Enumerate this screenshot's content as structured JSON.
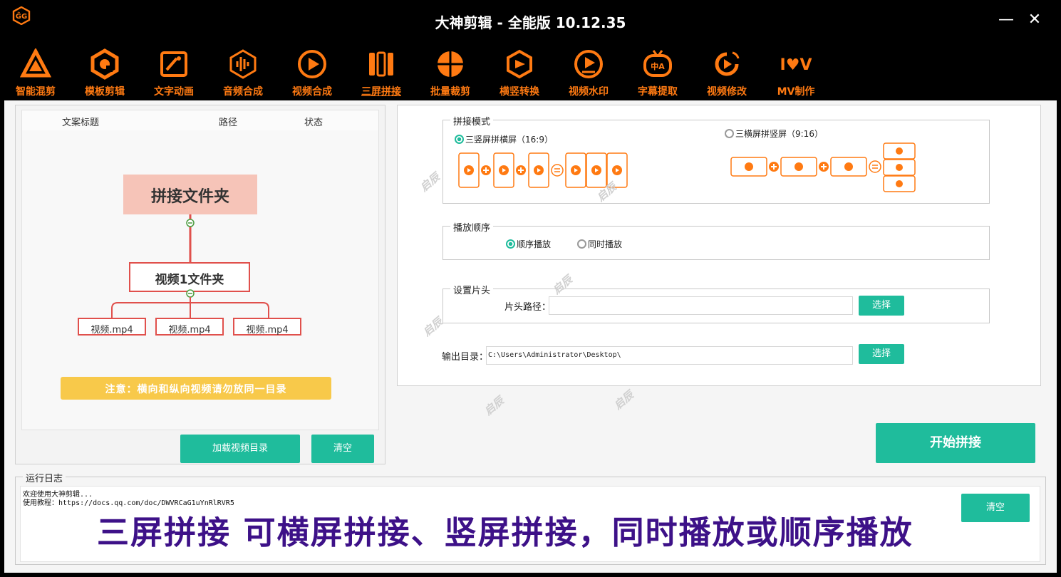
{
  "window": {
    "title": "大神剪辑 - 全能版 10.12.35",
    "minimize": "—",
    "close": "✕"
  },
  "toolbar": [
    {
      "label": "智能混剪",
      "icon": "triangle-logo-icon"
    },
    {
      "label": "模板剪辑",
      "icon": "hexagon-template-icon"
    },
    {
      "label": "文字动画",
      "icon": "text-frame-icon"
    },
    {
      "label": "音频合成",
      "icon": "audio-wave-icon"
    },
    {
      "label": "视频合成",
      "icon": "video-play-icon"
    },
    {
      "label": "三屏拼接",
      "icon": "three-panel-icon"
    },
    {
      "label": "批量裁剪",
      "icon": "crop-ball-icon"
    },
    {
      "label": "横竖转换",
      "icon": "rotate-cube-icon"
    },
    {
      "label": "视频水印",
      "icon": "watermark-icon"
    },
    {
      "label": "字幕提取",
      "icon": "subtitle-tv-icon"
    },
    {
      "label": "视频修改",
      "icon": "edit-play-icon"
    },
    {
      "label": "MV制作",
      "icon": "mv-logo-icon"
    }
  ],
  "active_tool": "三屏拼接",
  "list": {
    "columns": [
      "文案标题",
      "路径",
      "状态"
    ]
  },
  "diagram": {
    "root": "拼接文件夹",
    "child": "视频1文件夹",
    "leaves": [
      "视频.mp4",
      "视频.mp4",
      "视频.mp4"
    ],
    "notice": "注意：横向和纵向视频请勿放同一目录"
  },
  "left_buttons": {
    "load": "加载视频目录",
    "clear": "清空"
  },
  "mode": {
    "group": "拼接模式",
    "option1": "三竖屏拼横屏（16:9）",
    "option2": "三横屏拼竖屏（9:16）",
    "selected": "option1"
  },
  "order": {
    "group": "播放顺序",
    "option1": "顺序播放",
    "option2": "同时播放",
    "selected": "option1"
  },
  "intro": {
    "group": "设置片头",
    "path_label": "片头路径：",
    "path_value": "",
    "choose": "选择"
  },
  "output": {
    "label": "输出目录：",
    "value": "C:\\Users\\Administrator\\Desktop\\",
    "choose": "选择"
  },
  "start_button": "开始拼接",
  "log": {
    "title": "运行日志",
    "lines": [
      "欢迎使用大神剪辑...",
      "使用教程：https://docs.qq.com/doc/DWVRCaG1uYnRlRVR5"
    ],
    "clear": "清空"
  },
  "caption": "三屏拼接 可横屏拼接、竖屏拼接，同时播放或顺序播放",
  "watermark": "启辰",
  "colors": {
    "accent": "#ff7a12",
    "teal": "#1fbc9c",
    "caption": "#3d1188",
    "notice_bg": "#f8c94a",
    "root_bg": "#f6c4b8",
    "tree_line": "#e0504c"
  }
}
